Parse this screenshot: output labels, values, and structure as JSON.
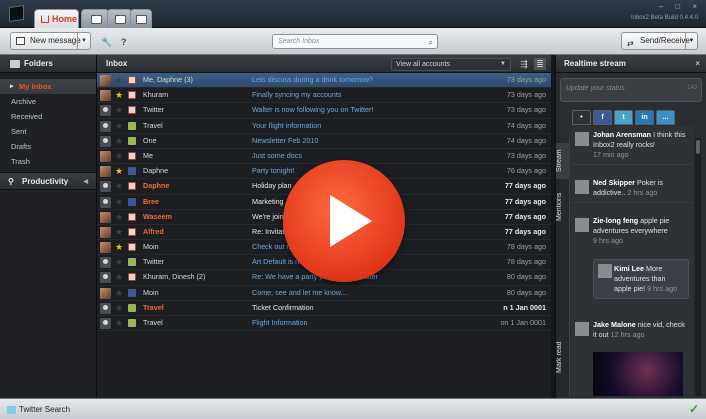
{
  "titlebar": {
    "tabs": [
      {
        "label": "Home",
        "icon": "home-icon",
        "active": true
      },
      {
        "label": "",
        "icon": "people-icon"
      },
      {
        "label": "",
        "icon": "document-icon"
      },
      {
        "label": "",
        "icon": "window-icon"
      }
    ],
    "app_name": "Inbox2 Beta Build 0.4.4.0"
  },
  "toolbar": {
    "new_message": "New message",
    "search_placeholder": "Search Inbox",
    "send_receive": "Send/Receive"
  },
  "sidebar": {
    "header": "Folders",
    "folders": [
      "My Inbox",
      "Archive",
      "Received",
      "Sent",
      "Drafts",
      "Trash"
    ],
    "productivity": "Productivity"
  },
  "inbox": {
    "title": "Inbox",
    "view": "View all accounts",
    "rows": [
      {
        "from": "Me, Daphne (3)",
        "subject": "Lets discuss during a drink tomorrow?",
        "date": "73 days ago",
        "src": "mail",
        "star": false,
        "av": "photo",
        "unread": false
      },
      {
        "from": "Khuram",
        "subject": "Finally syncing my accounts",
        "date": "73 days ago",
        "src": "mail",
        "star": true,
        "av": "photo",
        "unread": false
      },
      {
        "from": "Twitter",
        "subject": "Walter is now following you on Twitter!",
        "date": "73 days ago",
        "src": "mail",
        "star": false,
        "av": "ghost",
        "unread": false
      },
      {
        "from": "Travel",
        "subject": "Your flight information",
        "date": "74 days ago",
        "src": "rss",
        "star": false,
        "av": "ghost",
        "unread": false
      },
      {
        "from": "One",
        "subject": "Newsletter Feb 2010",
        "date": "74 days ago",
        "src": "rss",
        "star": false,
        "av": "ghost",
        "unread": false
      },
      {
        "from": "Me",
        "subject": "Just some docs",
        "date": "73 days ago",
        "src": "mail",
        "star": false,
        "av": "photo",
        "unread": false
      },
      {
        "from": "Daphne",
        "subject": "Party tonight!",
        "date": "76 days ago",
        "src": "fb",
        "star": true,
        "av": "photo",
        "unread": false
      },
      {
        "from": "Daphne",
        "subject": "Holiday plan",
        "date": "77 days ago",
        "src": "mail",
        "star": false,
        "av": "ghost",
        "unread": true
      },
      {
        "from": "Bree",
        "subject": "Marketing",
        "date": "77 days ago",
        "src": "fb",
        "star": false,
        "av": "ghost",
        "unread": true
      },
      {
        "from": "Waseem",
        "subject": "We're joining you",
        "date": "77 days ago",
        "src": "mail",
        "star": false,
        "av": "photo",
        "unread": true
      },
      {
        "from": "Alfred",
        "subject": "Re: Invitation ba",
        "date": "77 days ago",
        "src": "mail",
        "star": false,
        "av": "photo",
        "unread": true
      },
      {
        "from": "Moin",
        "subject": "Check out my ne",
        "date": "78 days ago",
        "src": "mail",
        "star": true,
        "av": "photo",
        "unread": false
      },
      {
        "from": "Twitter",
        "subject": "Art Default is now fo",
        "date": "78 days ago",
        "src": "rss",
        "star": false,
        "av": "ghost",
        "unread": false
      },
      {
        "from": "Khuram, Dinesh (2)",
        "subject": "Re: We have a party planned for Walter",
        "date": "80 days ago",
        "src": "mail",
        "star": false,
        "av": "ghost",
        "unread": false
      },
      {
        "from": "Moin",
        "subject": "Come, see and let me know....",
        "date": "80 days ago",
        "src": "fb",
        "star": false,
        "av": "photo",
        "unread": false
      },
      {
        "from": "Travel",
        "subject": "Ticket Confirmation",
        "date": "n 1 Jan 0001",
        "src": "rss",
        "star": false,
        "av": "ghost",
        "unread": true
      },
      {
        "from": "Travel",
        "subject": "Flight Information",
        "date": "on 1 Jan 0001",
        "src": "rss",
        "star": false,
        "av": "ghost",
        "unread": false
      }
    ]
  },
  "stream": {
    "header": "Realtime stream",
    "status_placeholder": "Update your status",
    "status_count": "140",
    "networks": [
      "f",
      "t",
      "in",
      "..."
    ],
    "sidetabs": [
      "Stream",
      "Mentions",
      "Mark read"
    ],
    "items": [
      {
        "name": "Johan Arensman",
        "text": "I think this Inbox2 really rocks!",
        "time": "17 min ago"
      },
      {
        "name": "Ned Skipper",
        "text": "Poker is addictive..",
        "time": "2 hrs ago"
      },
      {
        "name": "Zie-long feng",
        "text": "apple pie adventures everywhere",
        "time": "9 hrs ago"
      },
      {
        "name": "Kimi Lee",
        "text": "More adventures than apple pie!",
        "time": "9 hrs ago"
      },
      {
        "name": "Jake Malone",
        "text": "nice vid, check it out",
        "time": "12 hrs ago"
      }
    ]
  },
  "bottombar": {
    "twitter_search": "Twitter Search"
  }
}
